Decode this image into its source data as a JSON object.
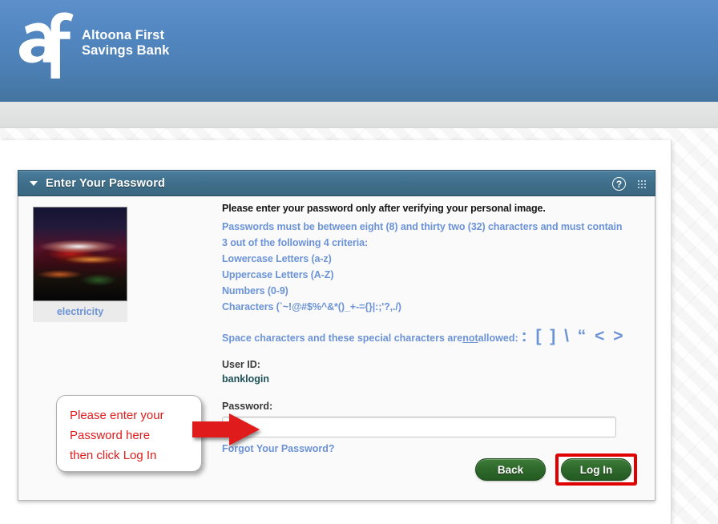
{
  "header": {
    "bank_name_line1": "Altoona First",
    "bank_name_line2": "Savings Bank",
    "logo_icon": "af-monogram-logo",
    "bg_top_color": "#5d90cb",
    "bg_bottom_color": "#44749f"
  },
  "panel": {
    "title": "Enter Your Password",
    "collapse_icon": "chevron-down-icon",
    "help_icon": "question-mark-circle-icon",
    "help_label": "?",
    "grip_icon": "drag-grip-icon",
    "header_color": "#3f6f8b"
  },
  "personal_image": {
    "caption": "electricity",
    "alt": "electricity-personal-image"
  },
  "instructions": {
    "lead": "Please enter your password only after verifying your personal image.",
    "rule_intro": "Passwords must be between eight (8) and thirty two (32) characters and must contain 3 out of the following 4 criteria:",
    "criteria": [
      "Lowercase Letters (a-z)",
      "Uppercase Letters (A-Z)",
      "Numbers (0-9)",
      "Characters (`~!@#$%^&*()_+-={}|:;'?,./)"
    ],
    "not_allowed_prefix": "Space characters and these special characters are ",
    "not_allowed_emphasis": "not",
    "not_allowed_suffix": " allowed:",
    "not_allowed_chars": ": [ ] \\ “ < >",
    "text_color": "#6b93d6"
  },
  "form": {
    "user_id_label": "User ID:",
    "user_id_value": "banklogin",
    "password_label": "Password:",
    "password_value": "",
    "password_placeholder": "",
    "forgot_link": "Forgot Your Password?"
  },
  "buttons": {
    "back": "Back",
    "login": "Log In",
    "login_highlight_color": "#e00000",
    "button_color": "#2f6a2c"
  },
  "annotation": {
    "callout_text": "Please enter your\nPassword here\nthen click Log In",
    "callout_color": "#e01b1b",
    "arrow_icon": "red-arrow-right-icon"
  }
}
